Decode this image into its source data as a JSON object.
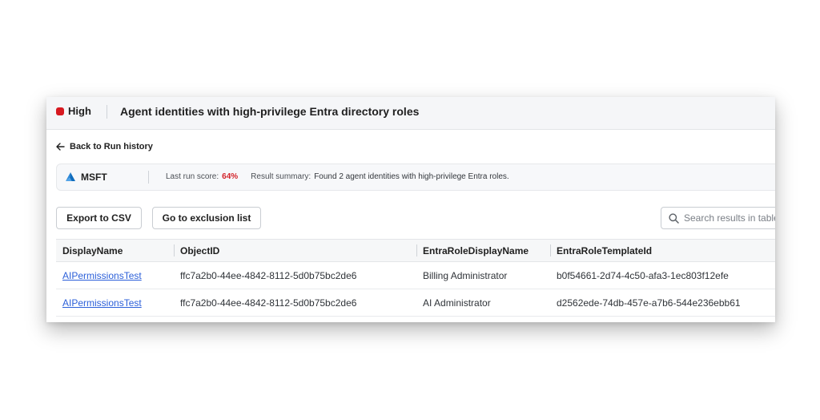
{
  "header": {
    "severity": "High",
    "severity_color": "#d71920",
    "title": "Agent identities with high-privilege Entra directory roles"
  },
  "nav": {
    "back_label": "Back to Run history"
  },
  "summary": {
    "tenant_icon": "azure-logo-icon",
    "tenant": "MSFT",
    "last_run_label": "Last run score:",
    "last_run_score": "64%",
    "score_color": "#d3232a",
    "result_label": "Result summary:",
    "result_text": "Found 2 agent identities with high-privilege Entra roles."
  },
  "toolbar": {
    "export_label": "Export to CSV",
    "exclusion_label": "Go to exclusion list",
    "search_placeholder": "Search results in table"
  },
  "table": {
    "columns": [
      "DisplayName",
      "ObjectID",
      "EntraRoleDisplayName",
      "EntraRoleTemplateId"
    ],
    "rows": [
      [
        "AIPermissionsTest",
        "ffc7a2b0-44ee-4842-8112-5d0b75bc2de6",
        "Billing Administrator",
        "b0f54661-2d74-4c50-afa3-1ec803f12efe"
      ],
      [
        "AIPermissionsTest",
        "ffc7a2b0-44ee-4842-8112-5d0b75bc2de6",
        "AI Administrator",
        "d2562ede-74db-457e-a7b6-544e236ebb61"
      ]
    ]
  }
}
